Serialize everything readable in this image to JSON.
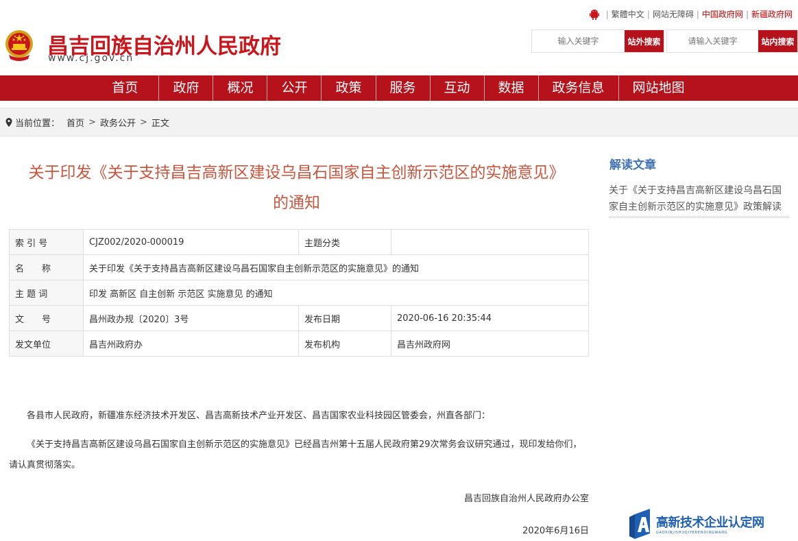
{
  "toplinks": {
    "traditional": "繁體中文",
    "accessible": "网站无障碍",
    "china_gov": "中国政府网",
    "xinjiang_gov": "新疆政府网"
  },
  "header": {
    "title": "昌吉回族自治州人民政府",
    "url": "www.cj.gov.cn"
  },
  "search": {
    "outer_placeholder": "输入关键字",
    "outer_button": "站外搜索",
    "inner_placeholder": "请输入关键字",
    "inner_button": "站内搜索"
  },
  "nav": {
    "items": [
      "首页",
      "政府",
      "概况",
      "公开",
      "政策",
      "服务",
      "互动",
      "数据",
      "政务信息",
      "网站地图"
    ]
  },
  "breadcrumb": {
    "label": "当前位置：",
    "items": [
      "首页",
      "政务公开",
      "正文"
    ]
  },
  "article": {
    "title_line1": "关于印发《关于支持昌吉高新区建设乌昌石国家自主创新示范区的实施意见》",
    "title_line2": "的通知",
    "meta": {
      "index_label": "索 引 号",
      "index_value": "CJZ002/2020-000019",
      "category_label": "主题分类",
      "category_value": "",
      "name_label": "名　　称",
      "name_value": "关于印发《关于支持昌吉高新区建设乌昌石国家自主创新示范区的实施意见》的通知",
      "keywords_label": "主 题 词",
      "keywords_value": "印发 高新区 自主创新 示范区 实施意见 的通知",
      "docno_label": "文　　号",
      "docno_value": "昌州政办规〔2020〕3号",
      "pubdate_label": "发布日期",
      "pubdate_value": "2020-06-16 20:35:44",
      "issuer_label": "发文单位",
      "issuer_value": "昌吉州政府办",
      "publisher_label": "发布机构",
      "publisher_value": "昌吉州政府网"
    },
    "addressee": "各县市人民政府，新疆准东经济技术开发区、昌吉高新技术产业开发区、昌吉国家农业科技园区管委会，州直各部门：",
    "paragraph": "《关于支持昌吉高新区建设乌昌石国家自主创新示范区的实施意见》已经昌吉州第十五届人民政府第29次常务会议研究通过，现印发给你们，请认真贯彻落实。",
    "signature": "昌吉回族自治州人民政府办公室",
    "date": "2020年6月16日"
  },
  "sidebar": {
    "title": "解读文章",
    "link": "关于《关于支持昌吉高新区建设乌昌石国家自主创新示范区的实施意见》政策解读"
  },
  "watermark": {
    "main": "高新技术企业认定网",
    "sub": "GAOXINJISHUQIYERENDINGWANG"
  },
  "colors": {
    "brand_red": "#b5121b",
    "title_red": "#c8161d",
    "article_title": "#c8553d",
    "sidebar_blue": "#4373b1",
    "watermark_blue": "#1f5fb4"
  }
}
